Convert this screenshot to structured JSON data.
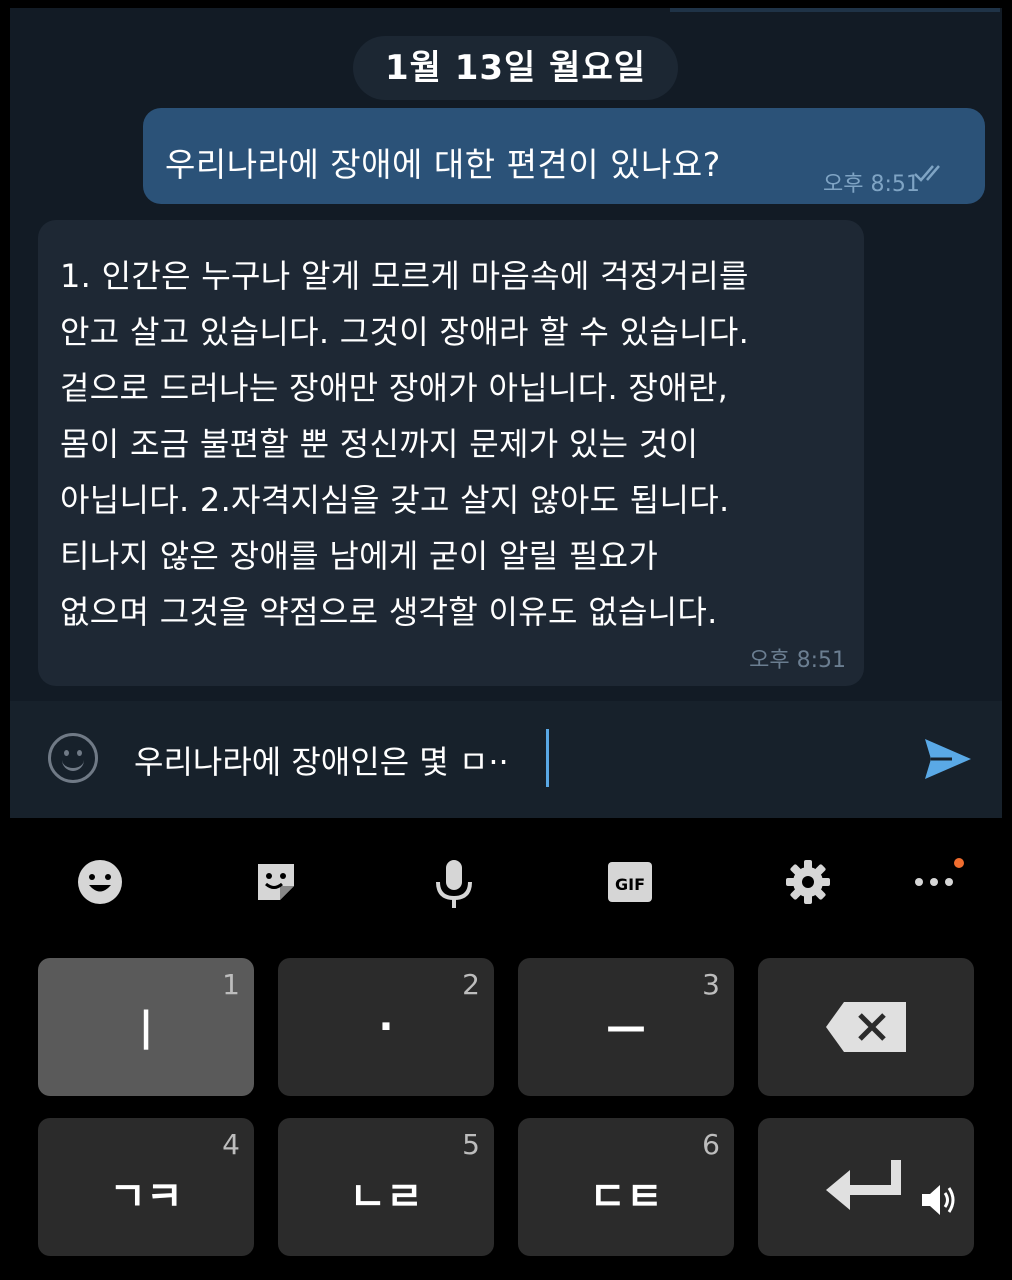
{
  "chat": {
    "date_divider": "1월 13일 월요일",
    "outgoing": {
      "text": "우리나라에 장애에 대한 편견이 있나요?",
      "time": "오후 8:51",
      "status_icon": "double-check-icon"
    },
    "incoming": {
      "text": "1. 인간은 누구나 알게 모르게 마음속에 걱정거리를\n안고 살고 있습니다. 그것이 장애라 할 수 있습니다.\n겉으로 드러나는 장애만 장애가 아닙니다. 장애란,\n몸이 조금 불편할 뿐 정신까지 문제가 있는 것이\n아닙니다. 2.자격지심을 갖고 살지 않아도 됩니다.\n티나지 않은 장애를 남에게 굳이 알릴 필요가\n없으며 그것을 약점으로 생각할 이유도 없습니다.",
      "time": "오후 8:51"
    }
  },
  "input_bar": {
    "text": "우리나라에 장애인은 몇 ㅁ··",
    "emoji_icon": "smiley-icon",
    "send_icon": "send-arrow-icon"
  },
  "keyboard": {
    "toolbar": [
      "emoji-icon",
      "sticker-icon",
      "mic-icon",
      "gif-icon",
      "settings-icon",
      "more-icon"
    ],
    "gif_label": "GIF",
    "keys": [
      {
        "num": "1",
        "label": "|"
      },
      {
        "num": "2",
        "label": "·"
      },
      {
        "num": "3",
        "label": "—"
      },
      {
        "num": "",
        "label": "✕"
      },
      {
        "num": "4",
        "label": "ㄱㅋ"
      },
      {
        "num": "5",
        "label": "ㄴㄹ"
      },
      {
        "num": "6",
        "label": "ㄷㅌ"
      },
      {
        "num": "",
        "label": "↵"
      }
    ]
  },
  "colors": {
    "chat_bg": "#121b25",
    "outgoing_bubble": "#2b5278",
    "incoming_bubble": "#1e2834",
    "send_accent": "#5aa9e6"
  }
}
